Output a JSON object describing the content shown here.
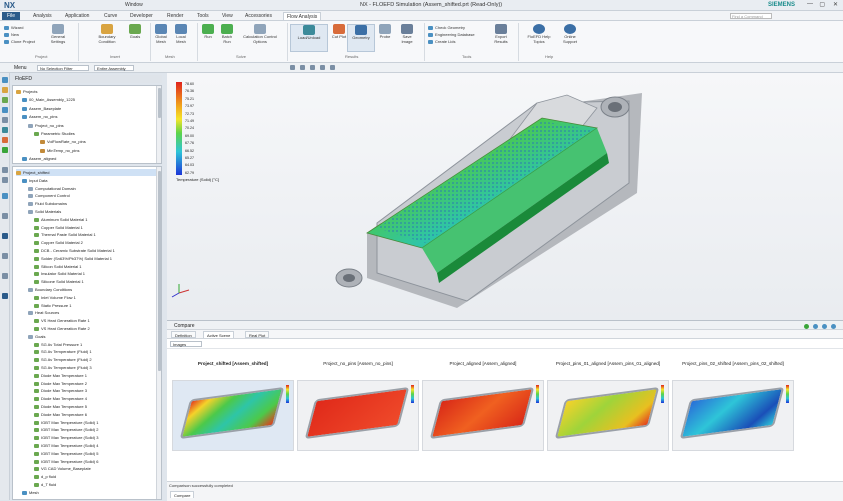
{
  "titlebar": {
    "app": "NX",
    "window_menu": "Window",
    "title": "NX - FLOEFD Simulation (Assem_shifted.prt (Read-Only))",
    "brand": "SIEMENS",
    "min": "—",
    "max": "▢",
    "close": "✕"
  },
  "menubar": {
    "tabs": [
      "File",
      "Analysis",
      "Application",
      "Curve",
      "Developer",
      "Render",
      "Tools",
      "View",
      "Accessories",
      "Flow Analysis"
    ],
    "search_placeholder": "Find a Command"
  },
  "ribbon": {
    "left": [
      "Wizard",
      "New",
      "Clone Project"
    ],
    "buttons": [
      {
        "label": "General Settings",
        "group": "Project"
      },
      {
        "label": "Boundary Condition",
        "group": "Insert"
      },
      {
        "label": "Goals",
        "group": "Insert"
      },
      {
        "label": "Global Mesh",
        "group": "Mesh"
      },
      {
        "label": "Local Mesh",
        "group": "Mesh"
      },
      {
        "label": "Run",
        "group": "Solve"
      },
      {
        "label": "Batch Run",
        "group": "Solve"
      },
      {
        "label": "Calculation Control Options",
        "group": "Solve"
      },
      {
        "label": "Load/Unload",
        "group": "Results"
      },
      {
        "label": "Cut Plot",
        "group": "Results"
      },
      {
        "label": "Geometry",
        "group": "Results"
      },
      {
        "label": "Probe",
        "group": "Results"
      },
      {
        "label": "Save Image",
        "group": "Results"
      },
      {
        "label": "Export Results",
        "group": "Tools"
      },
      {
        "label": "FloEFD Help Topics",
        "group": "Help"
      },
      {
        "label": "Online Support",
        "group": "Help"
      }
    ],
    "tools_small": [
      "Check Geometry",
      "Engineering Database",
      "Create Lids"
    ],
    "groups": [
      "Project",
      "Insert",
      "Mesh",
      "Solve",
      "Results",
      "Tools",
      "Help"
    ]
  },
  "selbar": {
    "menu": "Menu",
    "filter": "No Selection Filter",
    "scope": "Entire Assembly"
  },
  "navigator": {
    "title": "FloEFD"
  },
  "tree_top": [
    {
      "label": "Projects",
      "indent": 0
    },
    {
      "label": "00_Main_Assembly_1225",
      "indent": 1
    },
    {
      "label": "Assem_Baseplate",
      "indent": 1
    },
    {
      "label": "Assem_no_pins",
      "indent": 1
    },
    {
      "label": "Project_no_pins",
      "indent": 2
    },
    {
      "label": "Parametric Studies",
      "indent": 3
    },
    {
      "label": "VolFlowRate_no_pins",
      "indent": 4
    },
    {
      "label": "MinTemp_no_pins",
      "indent": 4
    },
    {
      "label": "Assem_aligned",
      "indent": 1
    }
  ],
  "tree_bottom": [
    {
      "label": "Project_shifted",
      "indent": 0
    },
    {
      "label": "Input Data",
      "indent": 1
    },
    {
      "label": "Computational Domain",
      "indent": 2
    },
    {
      "label": "Component Control",
      "indent": 2
    },
    {
      "label": "Fluid Subdomains",
      "indent": 2
    },
    {
      "label": "Solid Materials",
      "indent": 2
    },
    {
      "label": "Aluminum Solid Material 1",
      "indent": 3
    },
    {
      "label": "Copper Solid Material 1",
      "indent": 3
    },
    {
      "label": "Thermal Paste Solid Material 1",
      "indent": 3
    },
    {
      "label": "Copper Solid Material 2",
      "indent": 3
    },
    {
      "label": "DCB - Ceramic Substrate Solid Material 1",
      "indent": 3
    },
    {
      "label": "Solder (Sn63%/Pb37%) Solid Material 1",
      "indent": 3
    },
    {
      "label": "Silicon Solid Material 1",
      "indent": 3
    },
    {
      "label": "Insulator Solid Material 1",
      "indent": 3
    },
    {
      "label": "Silicone Solid Material 1",
      "indent": 3
    },
    {
      "label": "Boundary Conditions",
      "indent": 2
    },
    {
      "label": "Inlet Volume Flow 1",
      "indent": 3
    },
    {
      "label": "Static Pressure 1",
      "indent": 3
    },
    {
      "label": "Heat Sources",
      "indent": 2
    },
    {
      "label": "VS Heat Generation Rate 1",
      "indent": 3
    },
    {
      "label": "VS Heat Generation Rate 2",
      "indent": 3
    },
    {
      "label": "Goals",
      "indent": 2
    },
    {
      "label": "SG Av Total Pressure 1",
      "indent": 3
    },
    {
      "label": "SG Av Temperature (Fluid) 1",
      "indent": 3
    },
    {
      "label": "SG Av Temperature (Fluid) 2",
      "indent": 3
    },
    {
      "label": "SG Av Temperature (Fluid) 3",
      "indent": 3
    },
    {
      "label": "Diode Max Temperature 1",
      "indent": 3
    },
    {
      "label": "Diode Max Temperature 2",
      "indent": 3
    },
    {
      "label": "Diode Max Temperature 3",
      "indent": 3
    },
    {
      "label": "Diode Max Temperature 4",
      "indent": 3
    },
    {
      "label": "Diode Max Temperature 5",
      "indent": 3
    },
    {
      "label": "Diode Max Temperature 6",
      "indent": 3
    },
    {
      "label": "IGBT Max Temperature (Solid) 1",
      "indent": 3
    },
    {
      "label": "IGBT Max Temperature (Solid) 2",
      "indent": 3
    },
    {
      "label": "IGBT Max Temperature (Solid) 3",
      "indent": 3
    },
    {
      "label": "IGBT Max Temperature (Solid) 4",
      "indent": 3
    },
    {
      "label": "IGBT Max Temperature (Solid) 5",
      "indent": 3
    },
    {
      "label": "IGBT Max Temperature (Solid) 6",
      "indent": 3
    },
    {
      "label": "VG CAD Volume_Baseplate",
      "indent": 3
    },
    {
      "label": "d_p fluid",
      "indent": 3
    },
    {
      "label": "d_T fluid",
      "indent": 3
    },
    {
      "label": "Mesh",
      "indent": 1
    }
  ],
  "legend": {
    "values": [
      "78.60",
      "76.36",
      "75.21",
      "73.97",
      "72.73",
      "71.49",
      "70.24",
      "69.00",
      "67.76",
      "66.52",
      "65.27",
      "64.03",
      "62.79"
    ],
    "title": "Temperature (Solid) [°C]"
  },
  "compare": {
    "title": "Compare",
    "tabs": [
      "Definition",
      "Active Scene",
      "Real Plot"
    ],
    "images_dd": "Images",
    "columns": [
      {
        "header": "Project_shifted [Assem_shifted]",
        "bold": true,
        "style": "rainbow"
      },
      {
        "header": "Project_no_pins [Assem_no_pins]",
        "bold": false,
        "style": "red"
      },
      {
        "header": "Project_aligned [Assem_aligned]",
        "bold": false,
        "style": "red-pins"
      },
      {
        "header": "Project_pins_01_aligned [Assem_pins_01_aligned]",
        "bold": false,
        "style": "yellow"
      },
      {
        "header": "Project_pins_02_shifted [Assem_pins_02_shifted]",
        "bold": false,
        "style": "blue"
      }
    ],
    "status_msg": "Comparison successfully completed",
    "bottom_tab": "Compare"
  },
  "colors": {
    "accent": "#2b5b8a",
    "selection": "#cfe1f5",
    "ok_green": "#3aa53a",
    "brand": "#1a8c8c"
  }
}
